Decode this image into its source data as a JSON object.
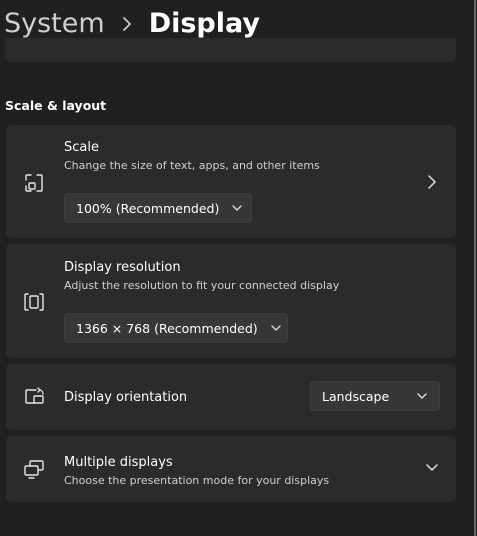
{
  "header": {
    "parent": "System",
    "separator_icon": "chevron-right-icon",
    "current": "Display"
  },
  "section": {
    "title": "Scale & layout"
  },
  "cards": {
    "scale": {
      "icon": "scale-icon",
      "title": "Scale",
      "description": "Change the size of text, apps, and other items",
      "dropdown_value": "100% (Recommended)",
      "arrow_icon": "chevron-right-icon"
    },
    "resolution": {
      "icon": "resolution-icon",
      "title": "Display resolution",
      "description": "Adjust the resolution to fit your connected display",
      "dropdown_value": "1366 × 768 (Recommended)"
    },
    "orientation": {
      "icon": "orientation-icon",
      "title": "Display orientation",
      "dropdown_value": "Landscape"
    },
    "multiple": {
      "icon": "multiple-displays-icon",
      "title": "Multiple displays",
      "description": "Choose the presentation mode for your displays",
      "expand_icon": "chevron-down-icon"
    }
  },
  "colors": {
    "background": "#202020",
    "card": "#2b2b2b",
    "dropdown": "#373737",
    "text": "#ffffff",
    "secondary_text": "#cfcfcf"
  }
}
